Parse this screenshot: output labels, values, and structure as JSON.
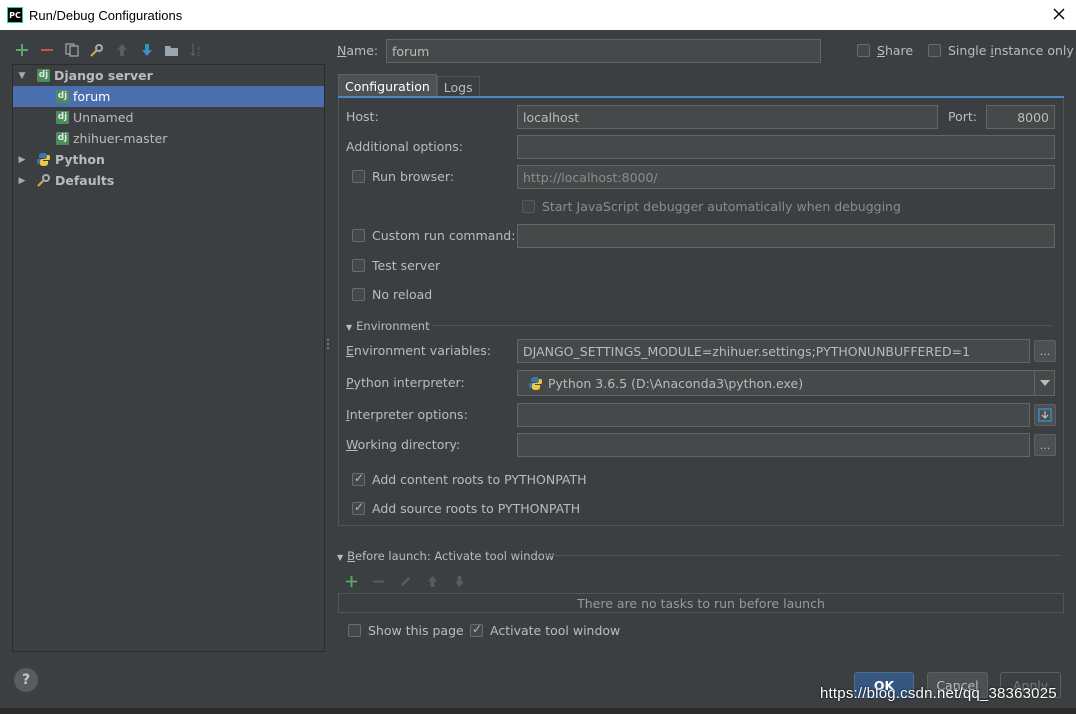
{
  "window": {
    "title": "Run/Debug Configurations",
    "app_icon_text": "PC"
  },
  "toolbar": {
    "icons": [
      "add-icon",
      "remove-icon",
      "copy-icon",
      "wrench-icon",
      "move-up-icon",
      "move-down-icon",
      "folder-icon",
      "sort-icon"
    ]
  },
  "tree": {
    "items": [
      {
        "label": "Django server",
        "icon": "dj",
        "level": 0,
        "expanded": true
      },
      {
        "label": "forum",
        "icon": "dj",
        "level": 1,
        "selected": true
      },
      {
        "label": "Unnamed",
        "icon": "dj",
        "level": 1
      },
      {
        "label": "zhihuer-master",
        "icon": "dj",
        "level": 1
      },
      {
        "label": "Python",
        "icon": "python",
        "level": 0,
        "expanded": false
      },
      {
        "label": "Defaults",
        "icon": "wrench",
        "level": 0,
        "expanded": false
      }
    ]
  },
  "header": {
    "name_label_u": "N",
    "name_label_rest": "ame:",
    "name_value": "forum",
    "share_u": "S",
    "share_rest": "hare",
    "share_checked": false,
    "single_pre": "Single ",
    "single_u": "i",
    "single_rest": "nstance only",
    "single_checked": false
  },
  "tabs": {
    "configuration": "Configuration",
    "logs": "Logs",
    "active": "configuration"
  },
  "config": {
    "host_label": "Host:",
    "host_value": "localhost",
    "port_label": "Port:",
    "port_value": "8000",
    "additional_label": "Additional options:",
    "additional_value": "",
    "run_browser_label": "Run browser:",
    "run_browser_checked": false,
    "run_browser_value": "http://localhost:8000/",
    "js_debugger_label": "Start JavaScript debugger automatically when debugging",
    "custom_run_label": "Custom run command:",
    "custom_run_value": "",
    "test_server_label": "Test server",
    "no_reload_label": "No reload",
    "environment_section": "Environment",
    "env_vars_u": "E",
    "env_vars_rest": "nvironment variables:",
    "env_vars_value": "DJANGO_SETTINGS_MODULE=zhihuer.settings;PYTHONUNBUFFERED=1",
    "interpreter_u": "P",
    "interpreter_rest": "ython interpreter:",
    "interpreter_value": "Python 3.6.5 (D:\\Anaconda3\\python.exe)",
    "interp_options_u": "I",
    "interp_options_rest": "nterpreter options:",
    "interp_options_value": "",
    "working_dir_u": "W",
    "working_dir_rest": "orking directory:",
    "working_dir_value": "",
    "content_roots_label": "Add content roots to PYTHONPATH",
    "content_roots_checked": true,
    "source_roots_label": "Add source roots to PYTHONPATH",
    "source_roots_checked": true,
    "ellipsis": "..."
  },
  "before_launch": {
    "title_u": "B",
    "title_rest": "efore launch: Activate tool window",
    "empty_text": "There are no tasks to run before launch",
    "show_page_label": "Show this page",
    "show_page_checked": false,
    "activate_label": "Activate tool window",
    "activate_checked": true
  },
  "buttons": {
    "ok": "OK",
    "cancel": "Cancel",
    "apply": "Apply",
    "help": "?"
  },
  "watermark": "https://blog.csdn.net/qq_38363025",
  "colors": {
    "accent": "#4b6eaf",
    "add_green": "#59a869",
    "remove_red": "#c75450",
    "move_blue": "#3592c4",
    "django_green": "#4a8c5b"
  }
}
